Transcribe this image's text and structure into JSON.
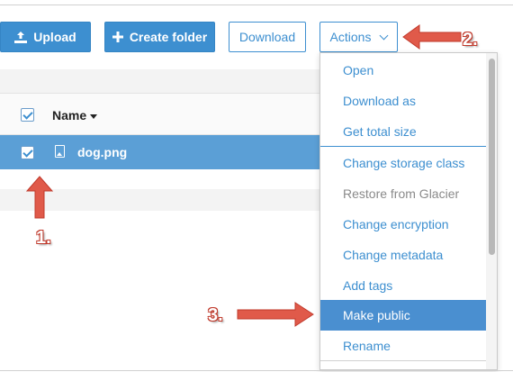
{
  "toolbar": {
    "upload_label": "Upload",
    "create_folder_label": "Create folder",
    "download_label": "Download",
    "actions_label": "Actions"
  },
  "table": {
    "header_name": "Name",
    "rows": [
      {
        "name": "dog.png",
        "selected": true
      }
    ]
  },
  "actions_menu": {
    "items": [
      {
        "label": "Open",
        "state": "enabled"
      },
      {
        "label": "Download as",
        "state": "enabled"
      },
      {
        "label": "Get total size",
        "state": "enabled"
      },
      {
        "label": "Change storage class",
        "state": "enabled"
      },
      {
        "label": "Restore from Glacier",
        "state": "disabled"
      },
      {
        "label": "Change encryption",
        "state": "enabled"
      },
      {
        "label": "Change metadata",
        "state": "enabled"
      },
      {
        "label": "Add tags",
        "state": "enabled"
      },
      {
        "label": "Make public",
        "state": "highlighted"
      },
      {
        "label": "Rename",
        "state": "enabled"
      }
    ]
  },
  "annotations": {
    "step1": "1.",
    "step2": "2.",
    "step3": "3."
  },
  "colors": {
    "accent": "#3d8fd0",
    "selected_row": "#5b9fd6",
    "annotation_arrow": "#e05a4a"
  }
}
